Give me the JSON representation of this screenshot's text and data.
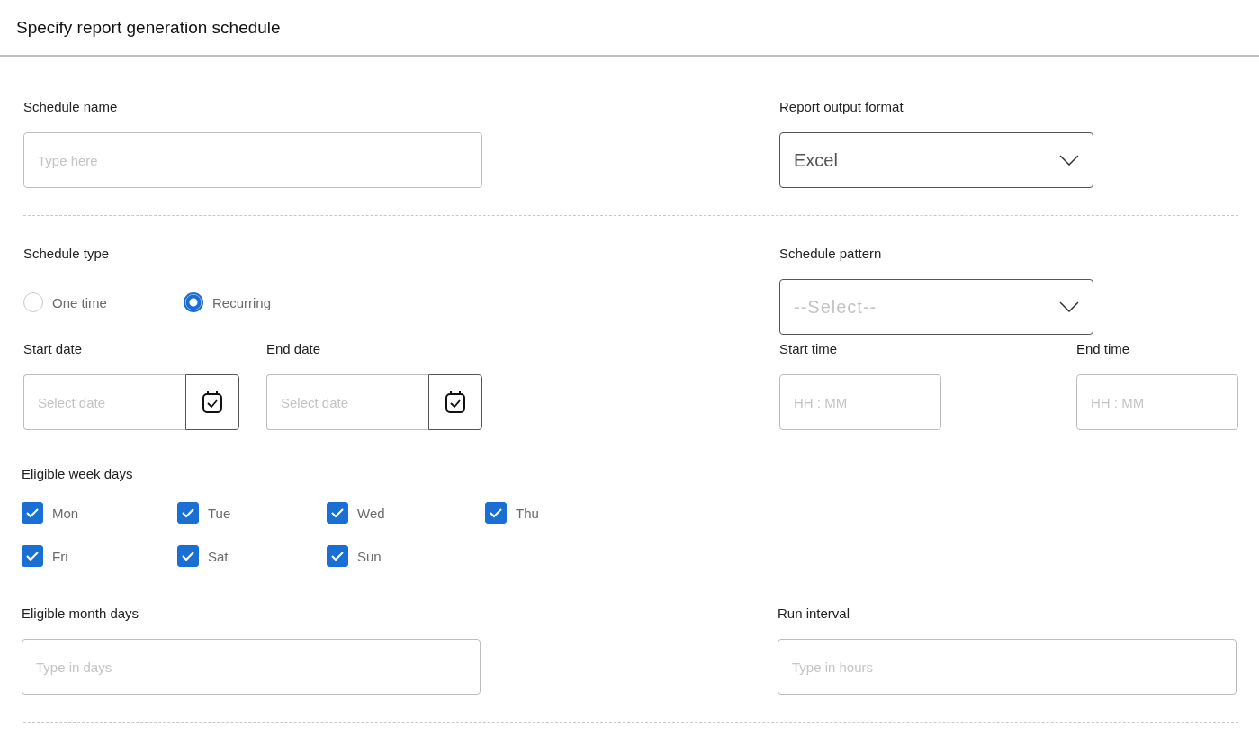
{
  "header": {
    "title": "Specify report generation schedule"
  },
  "schedule_name": {
    "label": "Schedule name",
    "placeholder": "Type here"
  },
  "output_format": {
    "label": "Report output format",
    "value": "Excel"
  },
  "schedule_type": {
    "label": "Schedule type",
    "options": [
      {
        "label": "One time",
        "selected": false
      },
      {
        "label": "Recurring",
        "selected": true
      }
    ]
  },
  "schedule_pattern": {
    "label": "Schedule pattern",
    "placeholder": "--Select--"
  },
  "start_date": {
    "label": "Start date",
    "placeholder": "Select date"
  },
  "end_date": {
    "label": "End date",
    "placeholder": "Select date"
  },
  "start_time": {
    "label": "Start time",
    "placeholder": "HH : MM"
  },
  "end_time": {
    "label": "End time",
    "placeholder": "HH : MM"
  },
  "week_days": {
    "label": "Eligible week days",
    "days": [
      {
        "label": "Mon",
        "checked": true
      },
      {
        "label": "Tue",
        "checked": true
      },
      {
        "label": "Wed",
        "checked": true
      },
      {
        "label": "Thu",
        "checked": true
      },
      {
        "label": "Fri",
        "checked": true
      },
      {
        "label": "Sat",
        "checked": true
      },
      {
        "label": "Sun",
        "checked": true
      }
    ]
  },
  "month_days": {
    "label": "Eligible month days",
    "placeholder": "Type in days"
  },
  "run_interval": {
    "label": "Run interval",
    "placeholder": "Type in hours"
  }
}
